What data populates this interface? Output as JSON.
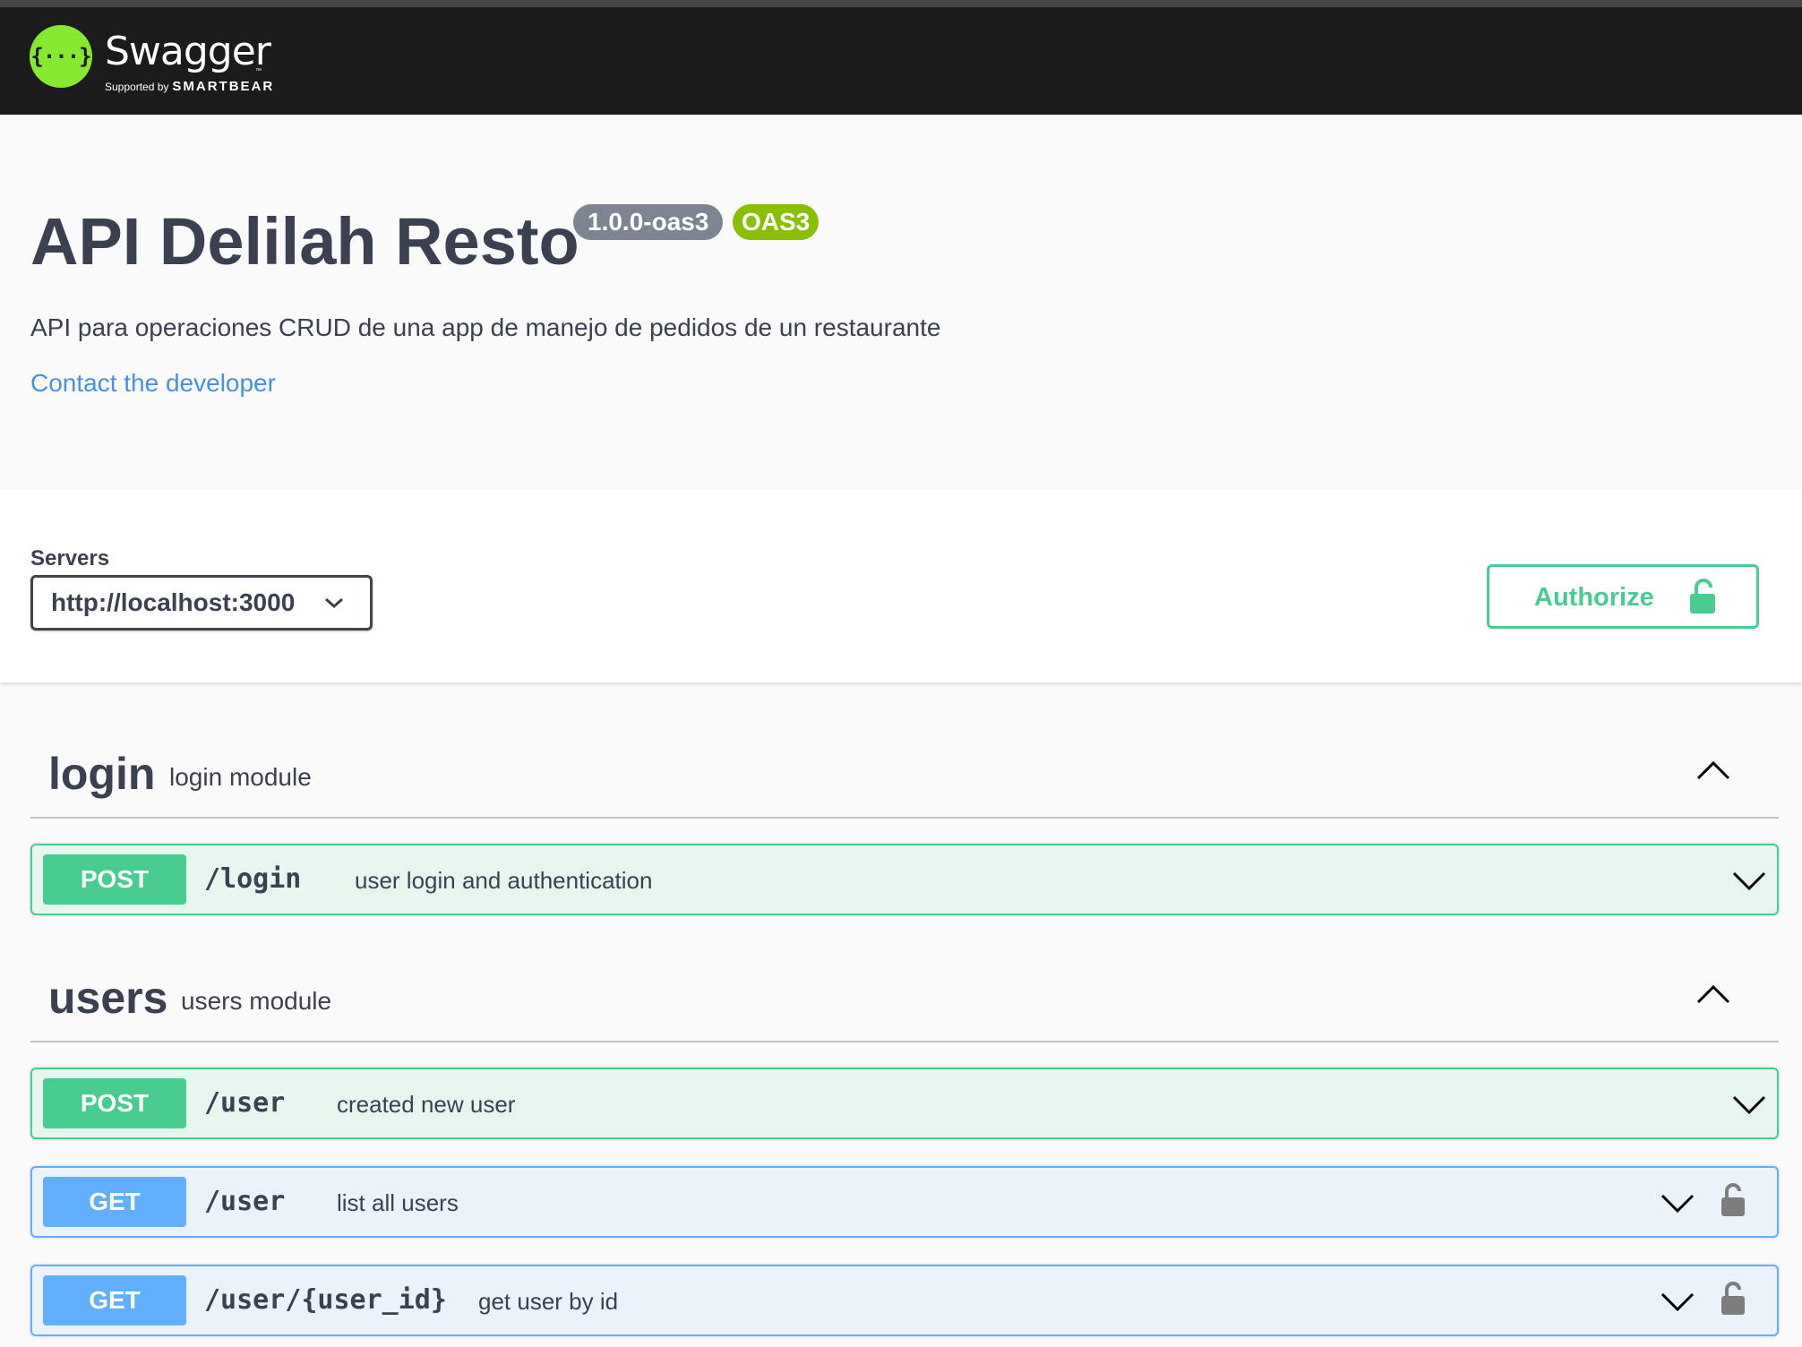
{
  "topbar": {
    "logo_glyph": "{···}",
    "logo_name": "Swagger",
    "logo_trademark": "™",
    "logo_supported_by": "Supported by",
    "logo_company": "SMARTBEAR"
  },
  "info": {
    "title": "API Delilah Resto",
    "version_badge": "1.0.0-oas3",
    "oas_badge": "OAS3",
    "description": "API para operaciones CRUD de una app de manejo de pedidos de un restaurante",
    "contact_link": "Contact the developer"
  },
  "servers": {
    "label": "Servers",
    "selected": "http://localhost:3000"
  },
  "authorize": {
    "label": "Authorize"
  },
  "tags": [
    {
      "name": "login",
      "description": "login module",
      "operations": [
        {
          "method": "POST",
          "path": "/login",
          "summary": "user login and authentication",
          "locked": false
        }
      ]
    },
    {
      "name": "users",
      "description": "users module",
      "operations": [
        {
          "method": "POST",
          "path": "/user",
          "summary": "created new user",
          "locked": false
        },
        {
          "method": "GET",
          "path": "/user",
          "summary": "list all users",
          "locked": true
        },
        {
          "method": "GET",
          "path": "/user/{user_id}",
          "summary": "get user by id",
          "locked": true
        }
      ]
    }
  ],
  "colors": {
    "post": "#49cc90",
    "get": "#61afe",
    "topbar": "#1b1b1b",
    "logo": "#85ea2d",
    "link": "#4990e2"
  }
}
